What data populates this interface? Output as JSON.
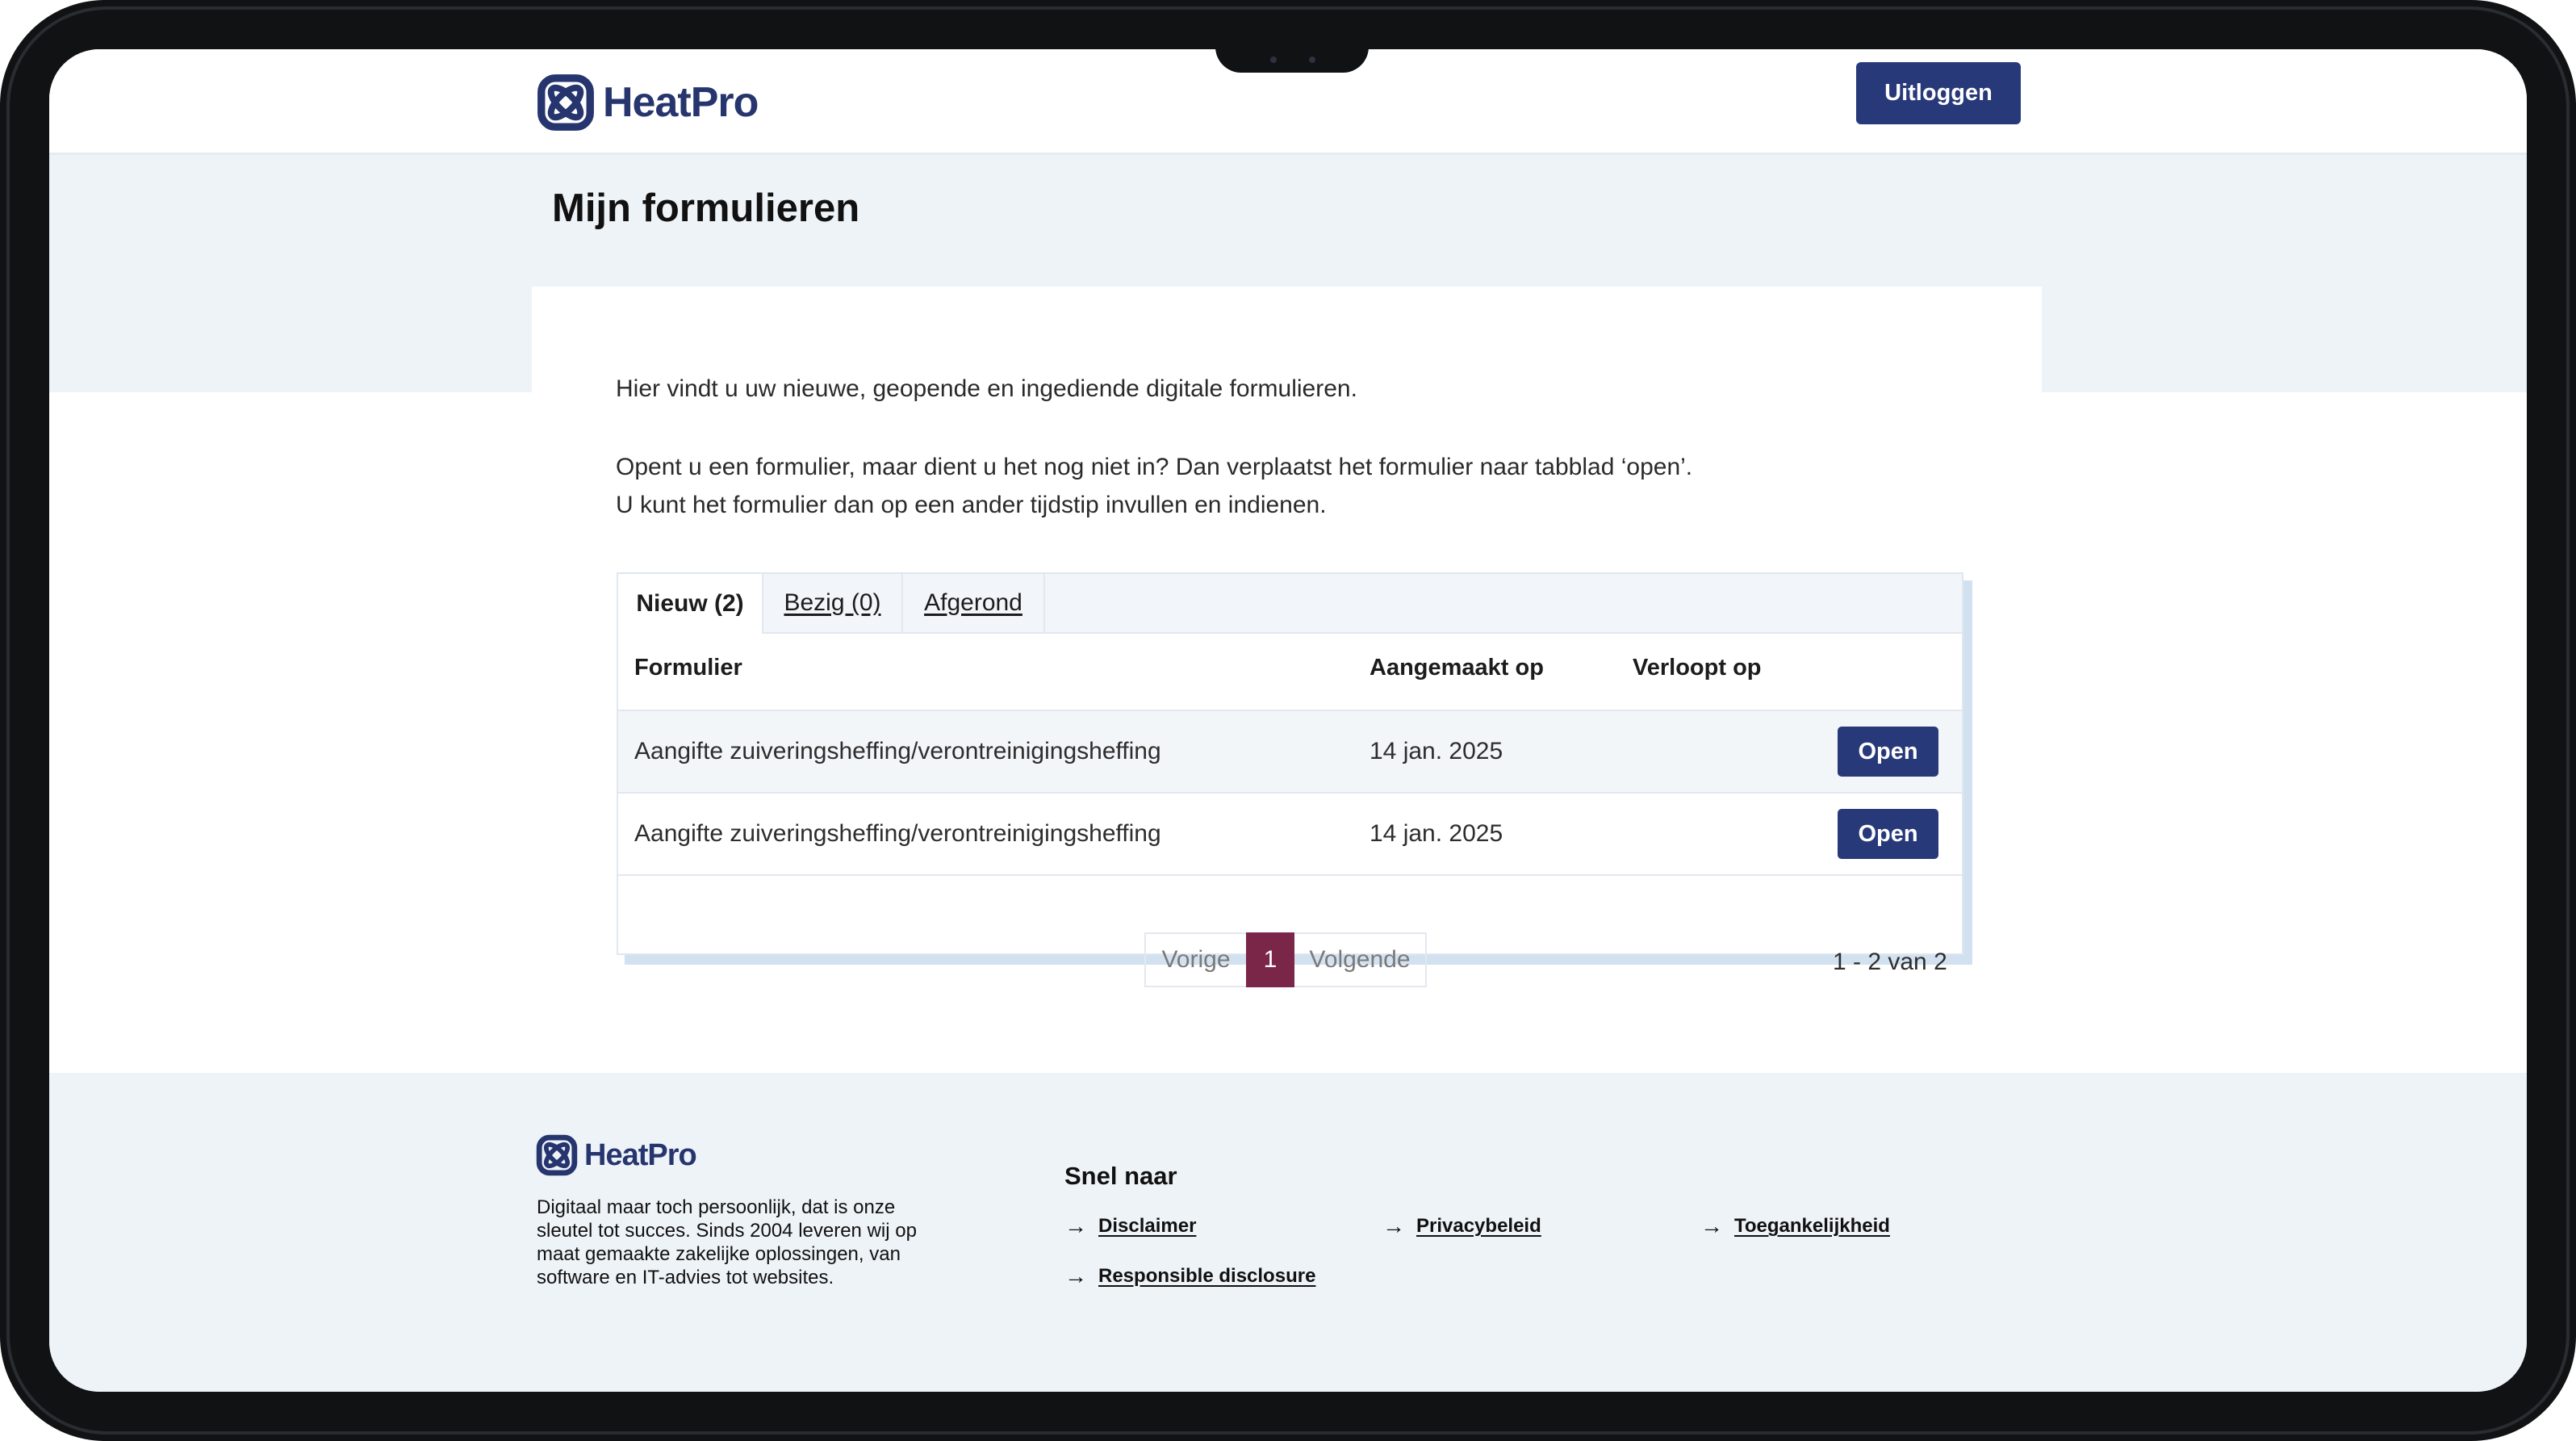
{
  "brand": {
    "name": "HeatPro",
    "primary_color": "#28397a",
    "accent_color": "#7a2648",
    "logo_icon": "heatpro-logo-icon"
  },
  "header": {
    "logout_label": "Uitloggen"
  },
  "page": {
    "title": "Mijn formulieren",
    "intro_1": "Hier vindt u uw nieuwe, geopende en ingediende digitale formulieren.",
    "intro_2": "Opent u een formulier, maar dient u het nog niet in? Dan verplaatst het formulier naar tabblad ‘open’.",
    "intro_3": "U kunt het formulier dan op een ander tijdstip invullen en indienen."
  },
  "tabs": [
    {
      "label": "Nieuw (2)",
      "active": true
    },
    {
      "label": "Bezig (0)",
      "active": false
    },
    {
      "label": "Afgerond",
      "active": false
    }
  ],
  "table": {
    "columns": [
      "Formulier",
      "Aangemaakt op",
      "Verloopt op"
    ],
    "rows": [
      {
        "form": "Aangifte zuiveringsheffing/verontreinigingsheffing",
        "created": "14 jan. 2025",
        "expires": "",
        "action": "Open"
      },
      {
        "form": "Aangifte zuiveringsheffing/verontreinigingsheffing",
        "created": "14 jan. 2025",
        "expires": "",
        "action": "Open"
      }
    ]
  },
  "pagination": {
    "prev_label": "Vorige",
    "current_page": "1",
    "next_label": "Volgende",
    "count_label": "1 - 2 van 2"
  },
  "footer": {
    "description": "Digitaal maar toch persoonlijk, dat is onze sleutel tot succes. Sinds 2004 leveren wij op maat gemaakte zakelijke oplossingen, van software en IT-advies tot websites.",
    "heading": "Snel naar",
    "links": [
      "Disclaimer",
      "Privacybeleid",
      "Toegankelijkheid",
      "Responsible disclosure"
    ],
    "link_icon": "arrow-right-icon"
  }
}
